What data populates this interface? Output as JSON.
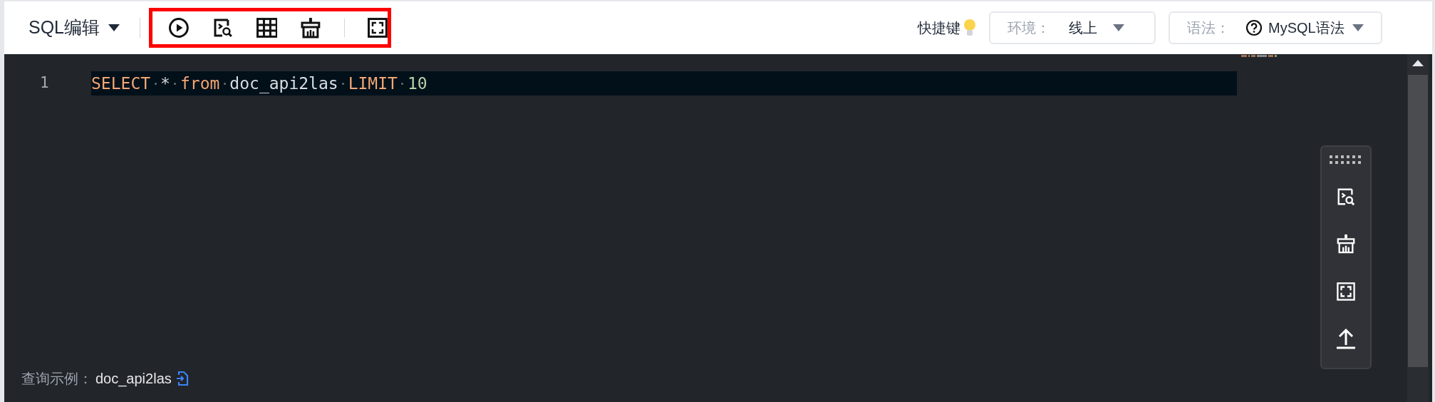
{
  "editor_title": "SQL编辑",
  "shortcuts_label": "快捷键",
  "environment": {
    "label": "环境：",
    "value": "线上"
  },
  "syntax": {
    "label": "语法：",
    "value": "MySQL语法"
  },
  "code_lines": [
    {
      "number": "1",
      "tokens": [
        {
          "kind": "keyword",
          "text": "SELECT"
        },
        {
          "kind": "operator",
          "text": "*"
        },
        {
          "kind": "keyword",
          "text": "from"
        },
        {
          "kind": "identifier",
          "text": "doc_api2las"
        },
        {
          "kind": "keyword",
          "text": "LIMIT"
        },
        {
          "kind": "number",
          "text": "10"
        }
      ]
    }
  ],
  "example": {
    "label": "查询示例：",
    "value": "doc_api2las"
  }
}
